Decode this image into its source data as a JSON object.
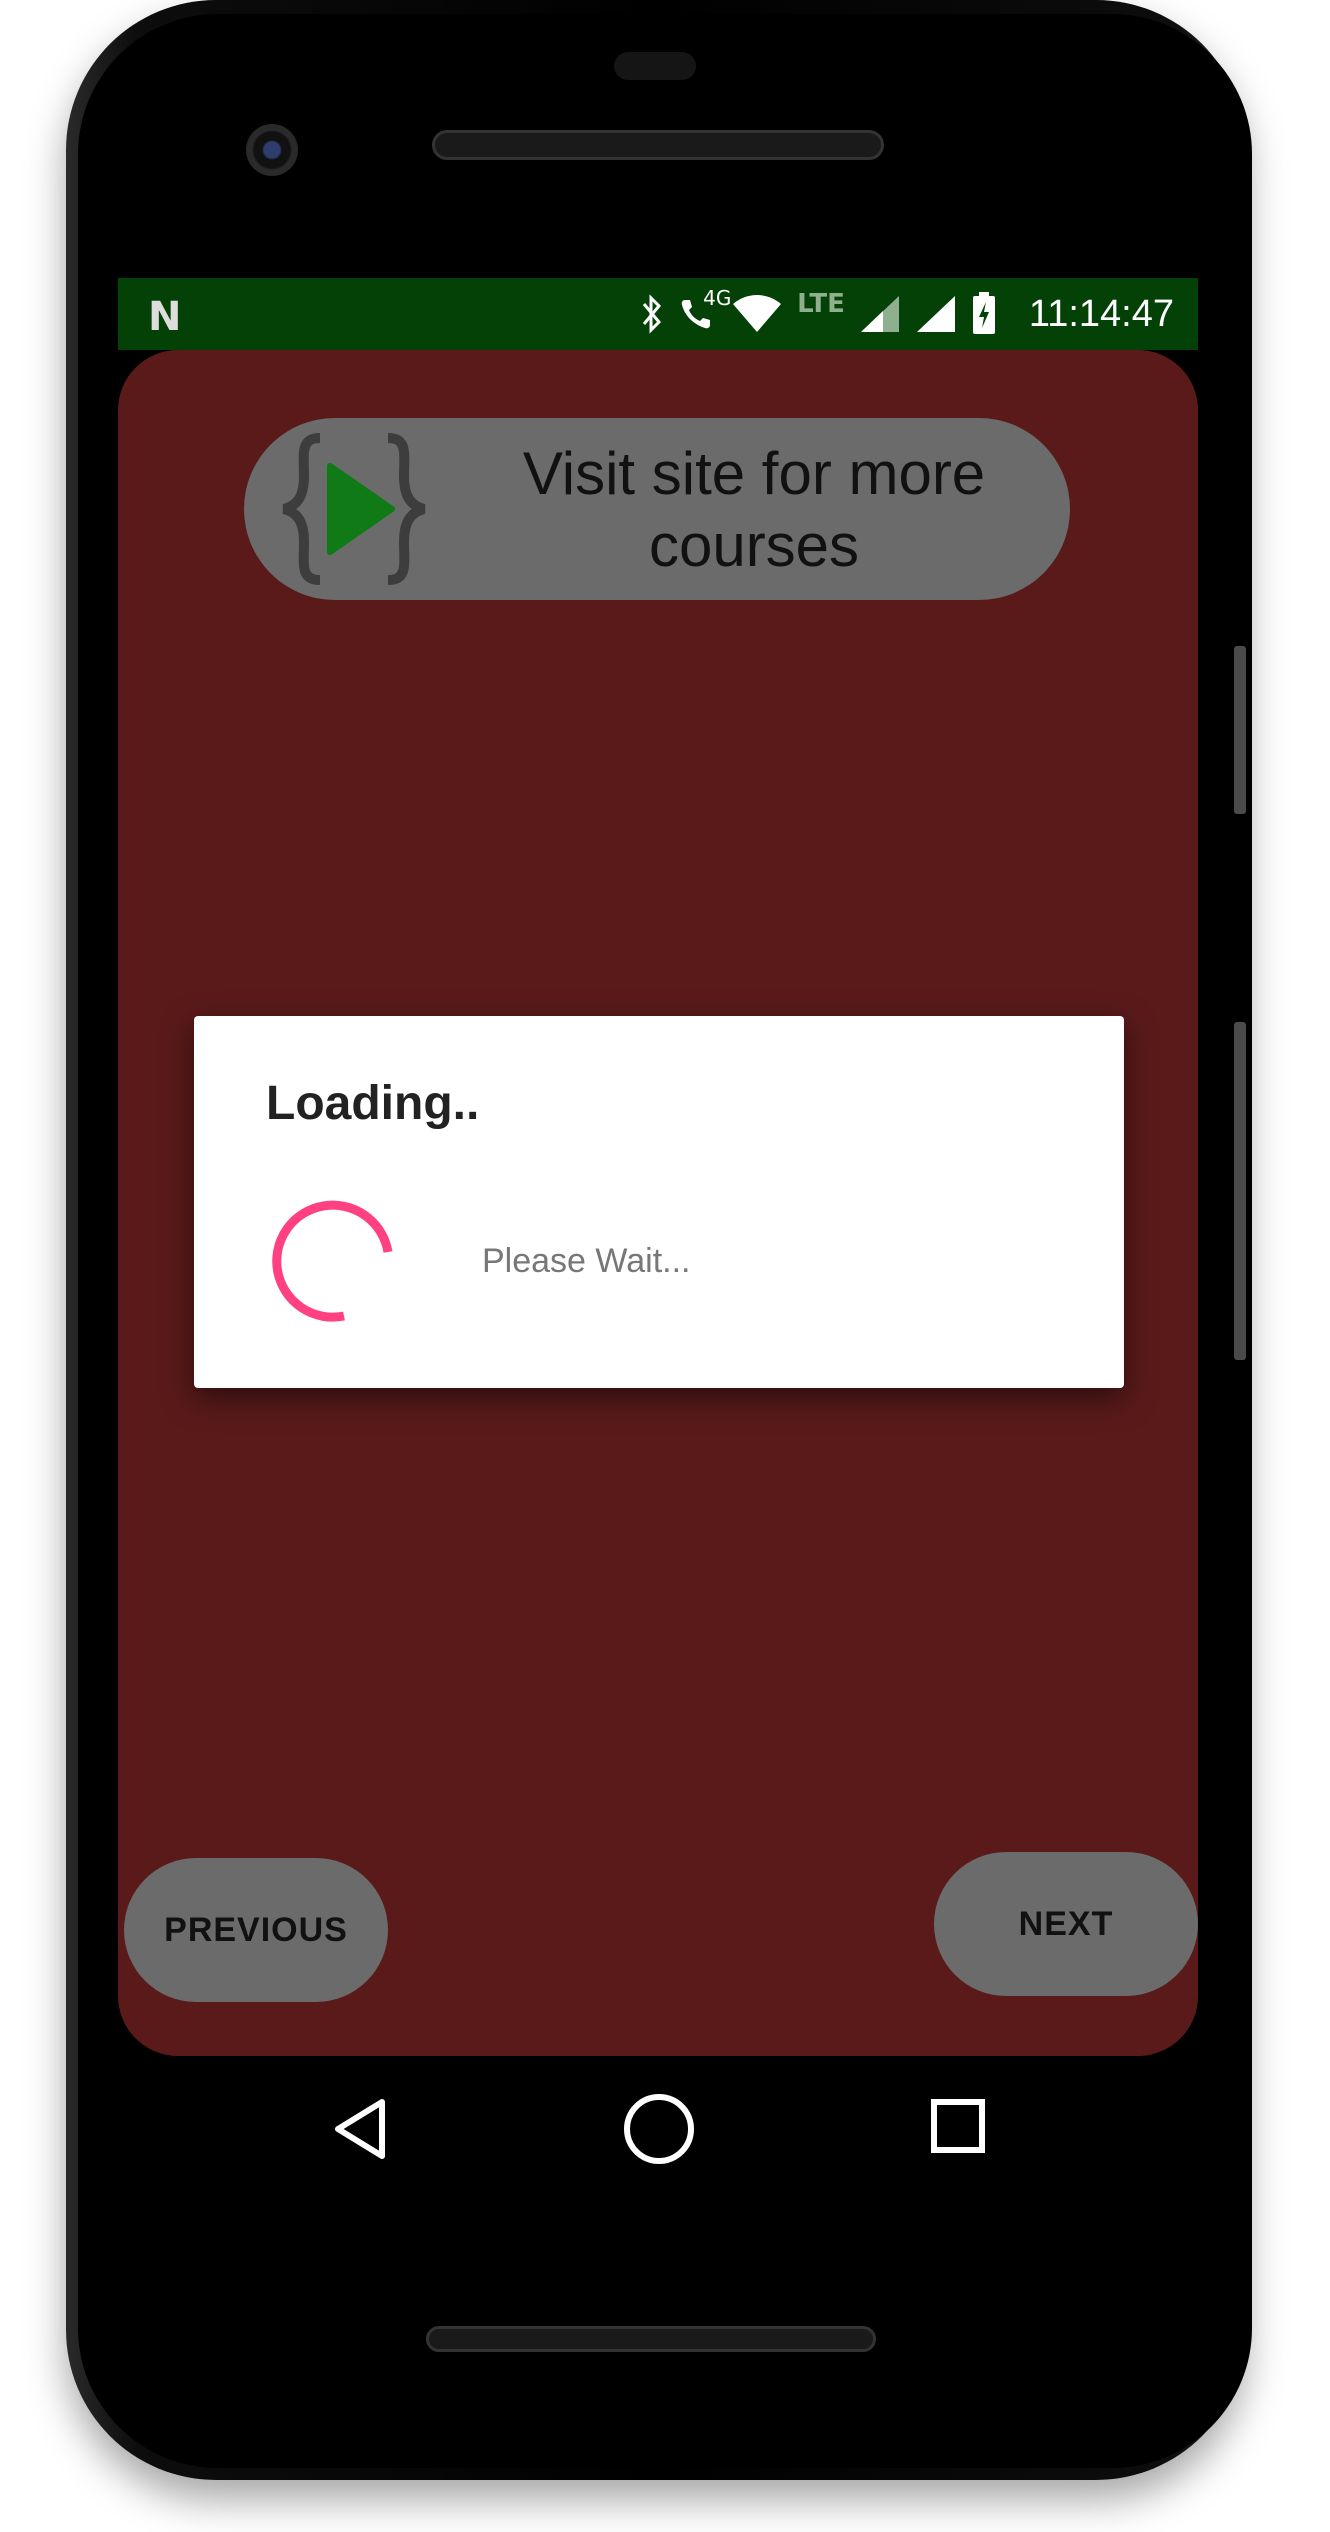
{
  "status_bar": {
    "time": "11:14:47",
    "network_type": "LTE",
    "call_badge": "4G",
    "icons": [
      "notification-n-icon",
      "bluetooth-icon",
      "wifi-calling-icon",
      "wifi-icon",
      "signal-icon",
      "signal-icon",
      "battery-charging-icon"
    ],
    "background_color": "#034107"
  },
  "main": {
    "site_button_label": "Visit site for more courses",
    "previous_label": "PREVIOUS",
    "next_label": "NEXT",
    "background_color": "#5a1a1a",
    "button_color": "#6b6b6b"
  },
  "dialog": {
    "title": "Loading..",
    "message": "Please Wait...",
    "spinner_color": "#ff4081"
  },
  "nav_bar": {
    "icons": [
      "back-icon",
      "home-icon",
      "recents-icon"
    ]
  }
}
